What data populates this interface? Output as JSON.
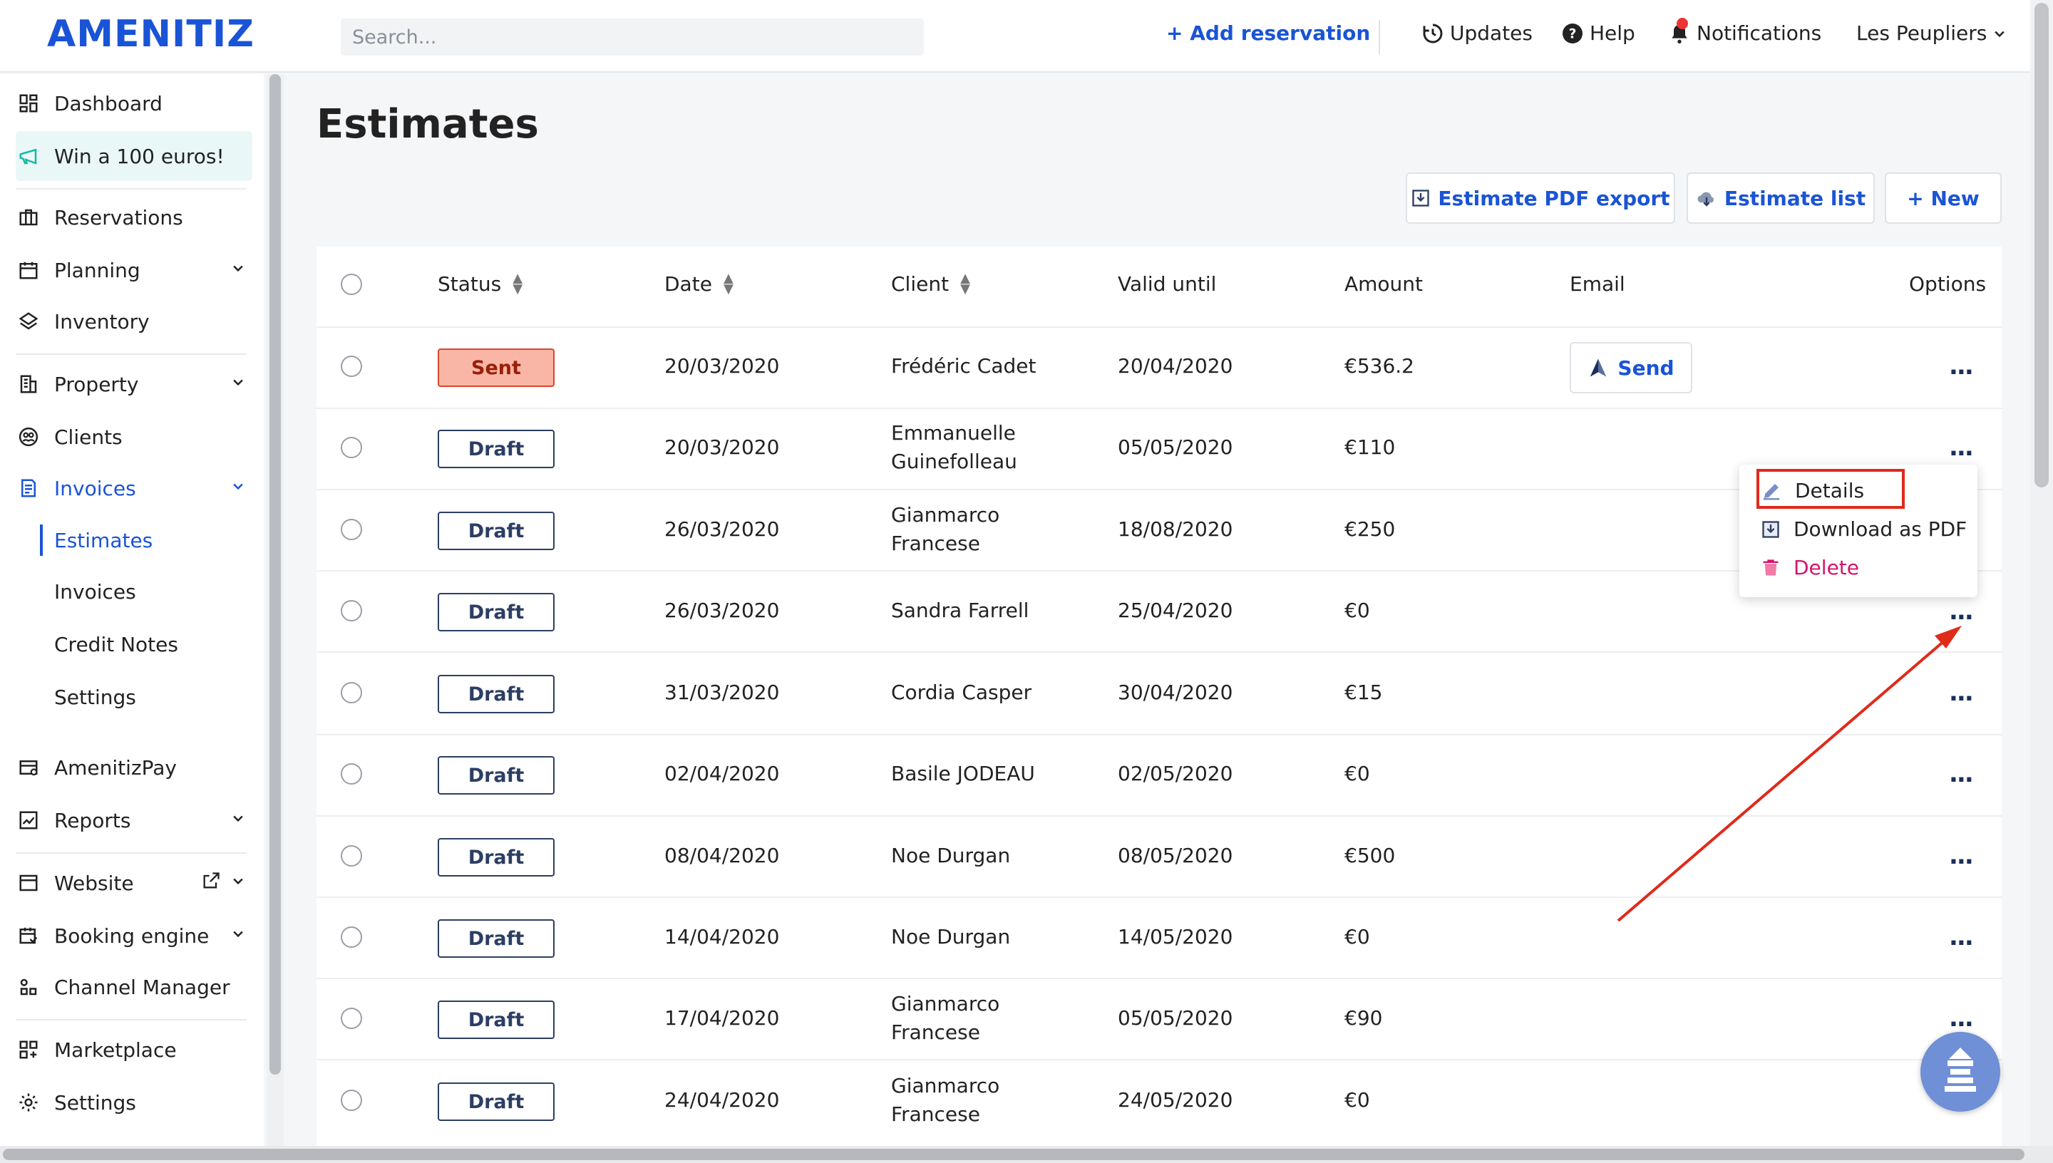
{
  "app": {
    "logo": "AMENITIZ",
    "search_placeholder": "Search...",
    "add_reservation": "+ Add reservation",
    "updates": "Updates",
    "help": "Help",
    "notifications": "Notifications",
    "property_name": "Les Peupliers"
  },
  "sidebar": {
    "dashboard": "Dashboard",
    "promo": "Win a 100 euros!",
    "reservations": "Reservations",
    "planning": "Planning",
    "inventory": "Inventory",
    "property": "Property",
    "clients": "Clients",
    "invoices": "Invoices",
    "sub": {
      "estimates": "Estimates",
      "invoices": "Invoices",
      "credit_notes": "Credit Notes",
      "settings": "Settings"
    },
    "amenitizpay": "AmenitizPay",
    "reports": "Reports",
    "website": "Website",
    "booking_engine": "Booking engine",
    "channel_manager": "Channel Manager",
    "marketplace": "Marketplace",
    "settings": "Settings"
  },
  "page": {
    "title": "Estimates",
    "buttons": {
      "pdf_export": "Estimate PDF export",
      "estimate_list": "Estimate list",
      "new": "+ New"
    }
  },
  "table": {
    "headers": {
      "status": "Status",
      "date": "Date",
      "client": "Client",
      "valid_until": "Valid until",
      "amount": "Amount",
      "email": "Email",
      "options": "Options"
    },
    "send_label": "Send",
    "options_label": "...",
    "rows": [
      {
        "status": "Sent",
        "date": "20/03/2020",
        "client1": "Frédéric Cadet",
        "client2": "",
        "valid": "20/04/2020",
        "amount": "€536.2"
      },
      {
        "status": "Draft",
        "date": "20/03/2020",
        "client1": "Emmanuelle",
        "client2": "Guinefolleau",
        "valid": "05/05/2020",
        "amount": "€110"
      },
      {
        "status": "Draft",
        "date": "26/03/2020",
        "client1": "Gianmarco",
        "client2": "Francese",
        "valid": "18/08/2020",
        "amount": "€250"
      },
      {
        "status": "Draft",
        "date": "26/03/2020",
        "client1": "Sandra Farrell",
        "client2": "",
        "valid": "25/04/2020",
        "amount": "€0"
      },
      {
        "status": "Draft",
        "date": "31/03/2020",
        "client1": "Cordia Casper",
        "client2": "",
        "valid": "30/04/2020",
        "amount": "€15"
      },
      {
        "status": "Draft",
        "date": "02/04/2020",
        "client1": "Basile JODEAU",
        "client2": "",
        "valid": "02/05/2020",
        "amount": "€0"
      },
      {
        "status": "Draft",
        "date": "08/04/2020",
        "client1": "Noe Durgan",
        "client2": "",
        "valid": "08/05/2020",
        "amount": "€500"
      },
      {
        "status": "Draft",
        "date": "14/04/2020",
        "client1": "Noe Durgan",
        "client2": "",
        "valid": "14/05/2020",
        "amount": "€0"
      },
      {
        "status": "Draft",
        "date": "17/04/2020",
        "client1": "Gianmarco",
        "client2": "Francese",
        "valid": "05/05/2020",
        "amount": "€90"
      },
      {
        "status": "Draft",
        "date": "24/04/2020",
        "client1": "Gianmarco",
        "client2": "Francese",
        "valid": "24/05/2020",
        "amount": "€0"
      }
    ]
  },
  "dropdown": {
    "details": "Details",
    "download_pdf": "Download as PDF",
    "delete": "Delete"
  },
  "colors": {
    "brand": "#1a54d6",
    "sent_bg": "#f9b6a6",
    "delete": "#d4146b",
    "annotation": "#e02a1a"
  }
}
